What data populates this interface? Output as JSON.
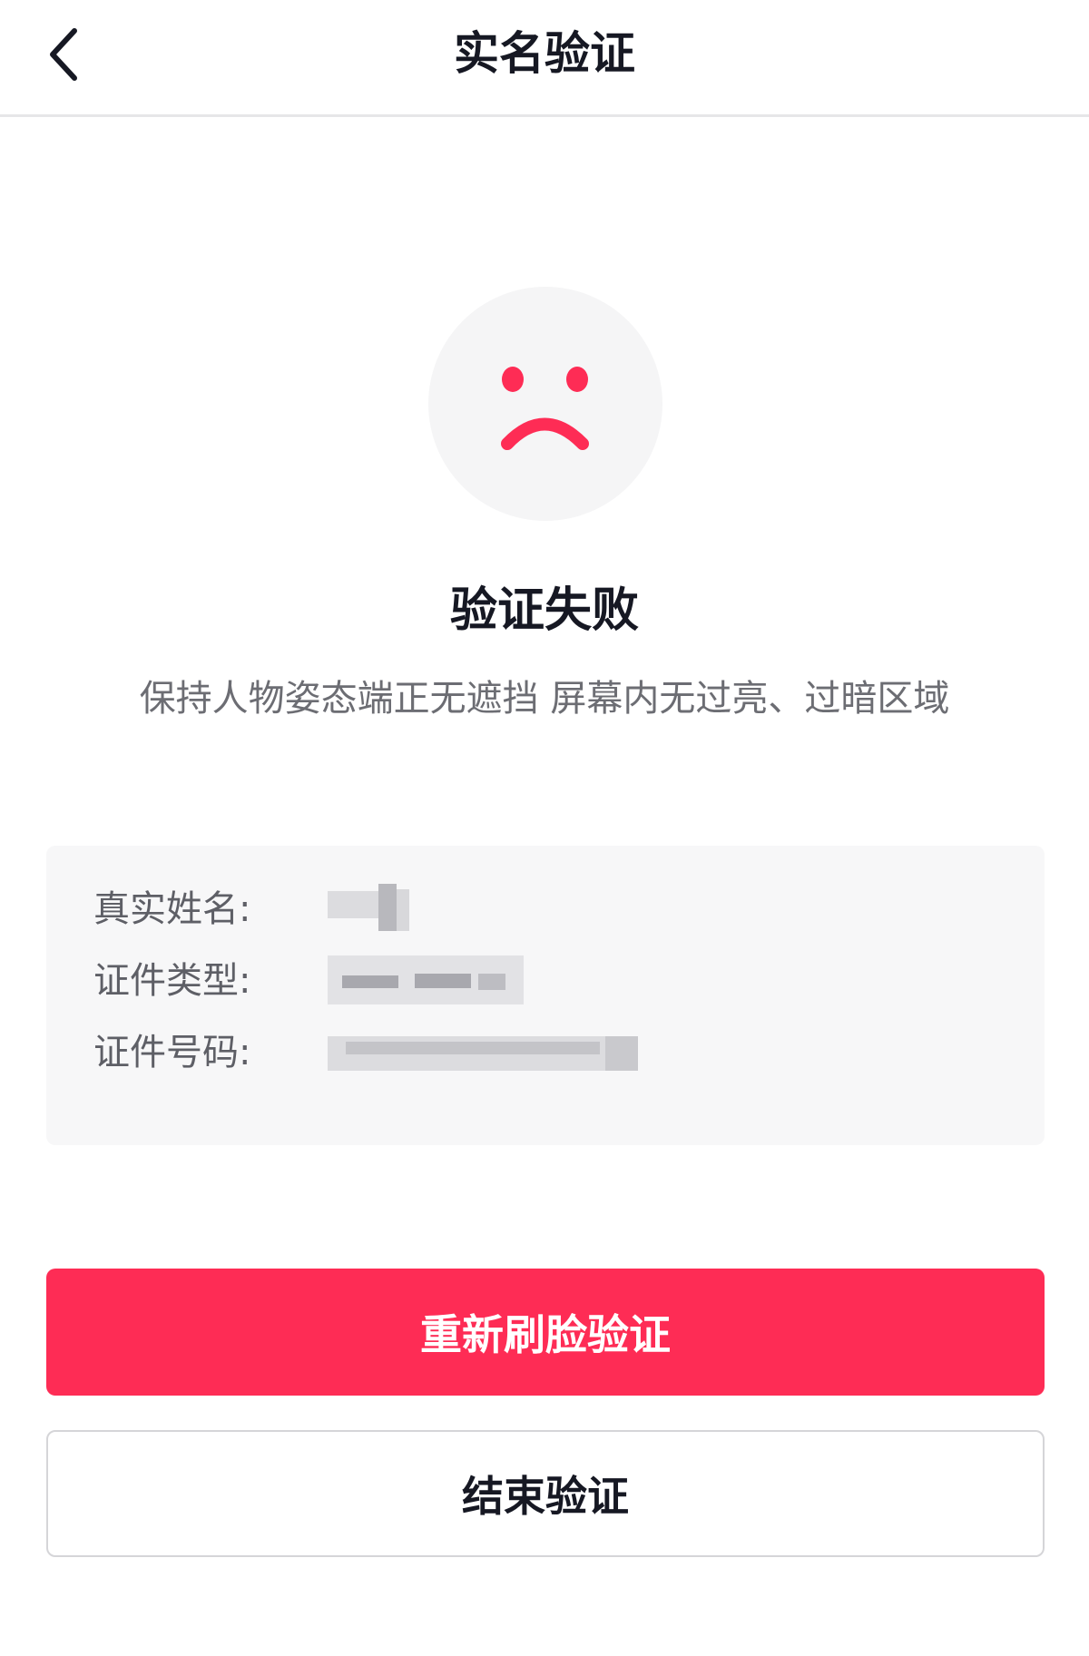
{
  "header": {
    "title": "实名验证",
    "back_icon": "chevron-left-icon"
  },
  "status": {
    "icon": "sad-face-icon",
    "icon_color": "#fe2c55",
    "title": "验证失败",
    "description": "保持人物姿态端正无遮挡 屏幕内无过亮、过暗区域"
  },
  "info": {
    "name_label": "真实姓名:",
    "id_type_label": "证件类型:",
    "id_number_label": "证件号码:"
  },
  "actions": {
    "retry_label": "重新刷脸验证",
    "end_label": "结束验证"
  },
  "colors": {
    "accent": "#fe2c55",
    "card_background": "#f7f7f8"
  }
}
